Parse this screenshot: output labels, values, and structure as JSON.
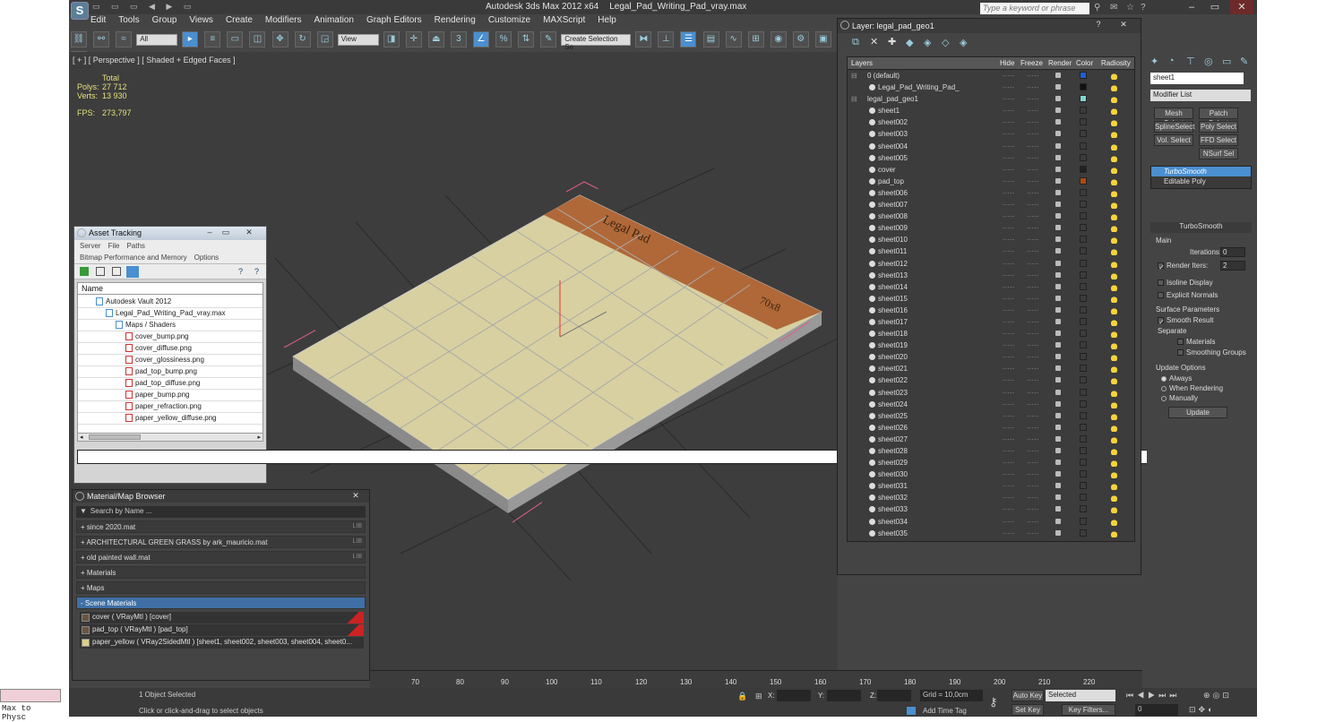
{
  "app": {
    "title": "Autodesk 3ds Max  2012 x64",
    "file": "Legal_Pad_Writing_Pad_vray.max",
    "search_placeholder": "Type a keyword or phrase",
    "logo": "S"
  },
  "menu": [
    "Edit",
    "Tools",
    "Group",
    "Views",
    "Create",
    "Modifiers",
    "Animation",
    "Graph Editors",
    "Rendering",
    "Customize",
    "MAXScript",
    "Help"
  ],
  "toolbar": {
    "filter": "All",
    "refcoord": "View",
    "selset": "Create Selection Se"
  },
  "viewport": {
    "label": "[ + ] [ Perspective ] [ Shaded + Edged Faces ]",
    "total_label": "Total",
    "polys_label": "Polys:",
    "polys": "27 712",
    "verts_label": "Verts:",
    "verts": "13 930",
    "fps_label": "FPS:",
    "fps": "273,797",
    "cover_text1": "Legal Pad",
    "cover_text2": "70x8"
  },
  "asset_tracking": {
    "title": "Asset Tracking",
    "menu1": [
      "Server",
      "File",
      "Paths"
    ],
    "menu2": [
      "Bitmap Performance and Memory",
      "Options"
    ],
    "col": "Name",
    "rows": [
      {
        "label": "Autodesk Vault 2012",
        "indent": 0
      },
      {
        "label": "Legal_Pad_Writing_Pad_vray.max",
        "indent": 1
      },
      {
        "label": "Maps / Shaders",
        "indent": 2
      },
      {
        "label": "cover_bump.png",
        "indent": 3
      },
      {
        "label": "cover_diffuse.png",
        "indent": 3
      },
      {
        "label": "cover_glossiness.png",
        "indent": 3
      },
      {
        "label": "pad_top_bump.png",
        "indent": 3
      },
      {
        "label": "pad_top_diffuse.png",
        "indent": 3
      },
      {
        "label": "paper_bump.png",
        "indent": 3
      },
      {
        "label": "paper_refraction.png",
        "indent": 3
      },
      {
        "label": "paper_yellow_diffuse.png",
        "indent": 3
      }
    ]
  },
  "material_browser": {
    "title": "Material/Map Browser",
    "search": "Search by Name ...",
    "groups": [
      {
        "label": "+ since 2020.mat",
        "lib": "LIB"
      },
      {
        "label": "+ ARCHITECTURAL GREEN GRASS by ark_mauricio.mat",
        "lib": "LIB"
      },
      {
        "label": "+ old painted wall.mat",
        "lib": "LIB"
      },
      {
        "label": "+ Materials",
        "lib": ""
      },
      {
        "label": "+ Maps",
        "lib": ""
      }
    ],
    "scene_group": "- Scene Materials",
    "materials": [
      "cover  ( VRayMtl )  [cover]",
      "pad_top  ( VRayMtl )  [pad_top]",
      "paper_yellow  ( VRay2SidedMtl )  [sheet1, sheet002, sheet003, sheet004, sheet0..."
    ]
  },
  "layer": {
    "title": "Layer: legal_pad_geo1",
    "cols": {
      "layers": "Layers",
      "hide": "Hide",
      "freeze": "Freeze",
      "render": "Render",
      "color": "Color",
      "radiosity": "Radiosity"
    },
    "rows": [
      {
        "name": "0 (default)",
        "top": true,
        "color": "#1f5fd0"
      },
      {
        "name": "Legal_Pad_Writing_Pad_",
        "top": false,
        "color": "#111111"
      },
      {
        "name": "legal_pad_geo1",
        "top": true,
        "color": "#7fd6d0"
      },
      {
        "name": "sheet1",
        "color": "#3c3c3c"
      },
      {
        "name": "sheet002",
        "color": "#3c3c3c"
      },
      {
        "name": "sheet003",
        "color": "#3c3c3c"
      },
      {
        "name": "sheet004",
        "color": "#3c3c3c"
      },
      {
        "name": "sheet005",
        "color": "#3c3c3c"
      },
      {
        "name": "cover",
        "color": "#222222"
      },
      {
        "name": "pad_top",
        "color": "#b04a10"
      },
      {
        "name": "sheet006",
        "color": "#3c3c3c"
      },
      {
        "name": "sheet007",
        "color": "#3c3c3c"
      },
      {
        "name": "sheet008",
        "color": "#3c3c3c"
      },
      {
        "name": "sheet009",
        "color": "#3c3c3c"
      },
      {
        "name": "sheet010",
        "color": "#3c3c3c"
      },
      {
        "name": "sheet011",
        "color": "#3c3c3c"
      },
      {
        "name": "sheet012",
        "color": "#3c3c3c"
      },
      {
        "name": "sheet013",
        "color": "#3c3c3c"
      },
      {
        "name": "sheet014",
        "color": "#3c3c3c"
      },
      {
        "name": "sheet015",
        "color": "#3c3c3c"
      },
      {
        "name": "sheet016",
        "color": "#3c3c3c"
      },
      {
        "name": "sheet017",
        "color": "#3c3c3c"
      },
      {
        "name": "sheet018",
        "color": "#3c3c3c"
      },
      {
        "name": "sheet019",
        "color": "#3c3c3c"
      },
      {
        "name": "sheet020",
        "color": "#3c3c3c"
      },
      {
        "name": "sheet021",
        "color": "#3c3c3c"
      },
      {
        "name": "sheet022",
        "color": "#3c3c3c"
      },
      {
        "name": "sheet023",
        "color": "#3c3c3c"
      },
      {
        "name": "sheet024",
        "color": "#3c3c3c"
      },
      {
        "name": "sheet025",
        "color": "#3c3c3c"
      },
      {
        "name": "sheet026",
        "color": "#3c3c3c"
      },
      {
        "name": "sheet027",
        "color": "#3c3c3c"
      },
      {
        "name": "sheet028",
        "color": "#3c3c3c"
      },
      {
        "name": "sheet029",
        "color": "#3c3c3c"
      },
      {
        "name": "sheet030",
        "color": "#3c3c3c"
      },
      {
        "name": "sheet031",
        "color": "#3c3c3c"
      },
      {
        "name": "sheet032",
        "color": "#3c3c3c"
      },
      {
        "name": "sheet033",
        "color": "#3c3c3c"
      },
      {
        "name": "sheet034",
        "color": "#3c3c3c"
      },
      {
        "name": "sheet035",
        "color": "#3c3c3c"
      }
    ]
  },
  "command": {
    "object_name": "sheet1",
    "modifier_list": "Modifier List",
    "buttons": [
      "Mesh Select",
      "Patch Select",
      "SplineSelect",
      "Poly Select",
      "Vol. Select",
      "FFD Select",
      "NSurf Sel"
    ],
    "stack": [
      "TurboSmooth",
      "Editable Poly"
    ],
    "turbo": {
      "title": "TurboSmooth",
      "main": "Main",
      "iterations_label": "Iterations:",
      "iterations": "0",
      "render_iters_label": "Render Iters:",
      "render_iters": "2",
      "isoline": "Isoline Display",
      "explicit": "Explicit Normals",
      "surface": "Surface Parameters",
      "smooth_result": "Smooth Result",
      "separate": "Separate",
      "materials": "Materials",
      "smoothing_groups": "Smoothing Groups",
      "update_options": "Update Options",
      "always": "Always",
      "when_rendering": "When Rendering",
      "manually": "Manually",
      "update": "Update"
    }
  },
  "timeline": {
    "ticks": [
      "70",
      "80",
      "90",
      "100",
      "110",
      "120",
      "130",
      "140",
      "150",
      "160",
      "170",
      "180",
      "190",
      "200",
      "210",
      "220"
    ]
  },
  "status": {
    "selected": "1 Object Selected",
    "prompt": "Click or click-and-drag to select objects",
    "x": "X:",
    "y": "Y:",
    "z": "Z:",
    "grid": "Grid = 10,0cm",
    "add_time_tag": "Add Time Tag",
    "auto_key": "Auto Key",
    "set_key": "Set Key",
    "selected_combo": "Selected",
    "key_filters": "Key Filters...",
    "frame": "0",
    "maxscript": "Max to Physc"
  }
}
